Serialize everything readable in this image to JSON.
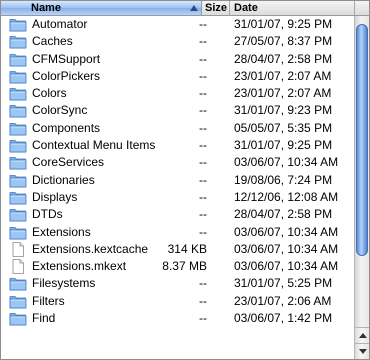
{
  "columns": {
    "name": "Name",
    "size": "Size",
    "date": "Date"
  },
  "accent": "#86b0ea",
  "rows": [
    {
      "name": "Automator",
      "size": "--",
      "date": "31/01/07, 9:25 PM",
      "icon": "folder-icon"
    },
    {
      "name": "Caches",
      "size": "--",
      "date": "27/05/07, 8:37 PM",
      "icon": "folder-icon"
    },
    {
      "name": "CFMSupport",
      "size": "--",
      "date": "28/04/07, 2:58 PM",
      "icon": "folder-icon"
    },
    {
      "name": "ColorPickers",
      "size": "--",
      "date": "23/01/07, 2:07 AM",
      "icon": "folder-icon"
    },
    {
      "name": "Colors",
      "size": "--",
      "date": "23/01/07, 2:07 AM",
      "icon": "folder-icon"
    },
    {
      "name": "ColorSync",
      "size": "--",
      "date": "31/01/07, 9:23 PM",
      "icon": "folder-icon"
    },
    {
      "name": "Components",
      "size": "--",
      "date": "05/05/07, 5:35 PM",
      "icon": "folder-icon"
    },
    {
      "name": "Contextual Menu Items",
      "size": "--",
      "date": "31/01/07, 9:25 PM",
      "icon": "folder-icon"
    },
    {
      "name": "CoreServices",
      "size": "--",
      "date": "03/06/07, 10:34 AM",
      "icon": "folder-icon"
    },
    {
      "name": "Dictionaries",
      "size": "--",
      "date": "19/08/06, 7:24 PM",
      "icon": "folder-icon"
    },
    {
      "name": "Displays",
      "size": "--",
      "date": "12/12/06, 12:08 AM",
      "icon": "folder-icon"
    },
    {
      "name": "DTDs",
      "size": "--",
      "date": "28/04/07, 2:58 PM",
      "icon": "folder-icon"
    },
    {
      "name": "Extensions",
      "size": "--",
      "date": "03/06/07, 10:34 AM",
      "icon": "folder-icon"
    },
    {
      "name": "Extensions.kextcache",
      "size": "314 KB",
      "date": "03/06/07, 10:34 AM",
      "icon": "document-icon"
    },
    {
      "name": "Extensions.mkext",
      "size": "8.37 MB",
      "date": "03/06/07, 10:34 AM",
      "icon": "document-icon"
    },
    {
      "name": "Filesystems",
      "size": "--",
      "date": "31/01/07, 5:25 PM",
      "icon": "folder-icon"
    },
    {
      "name": "Filters",
      "size": "--",
      "date": "23/01/07, 2:06 AM",
      "icon": "folder-icon"
    },
    {
      "name": "Find",
      "size": "--",
      "date": "03/06/07, 1:42 PM",
      "icon": "folder-icon"
    }
  ]
}
